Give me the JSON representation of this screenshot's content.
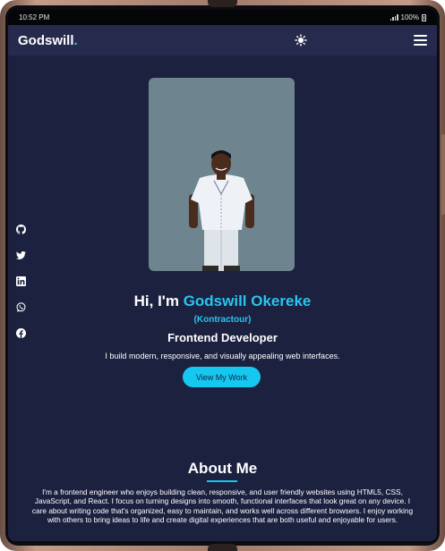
{
  "status_bar": {
    "time": "10:52 PM",
    "battery": "100%"
  },
  "navbar": {
    "logo_text": "Godswill",
    "logo_dot": "."
  },
  "hero": {
    "greeting_prefix": "Hi, I'm ",
    "name": "Godswill Okereke",
    "alias": "(Kontractour)",
    "role": "Frontend Developer",
    "tagline": "I build modern, responsive, and visually appealing web interfaces.",
    "cta_label": "View My Work"
  },
  "about": {
    "title": "About Me",
    "body": "I'm a frontend engineer who enjoys building clean, responsive, and user friendly websites using HTML5, CSS, JavaScript, and React. I focus on turning designs into smooth, functional interfaces that look great on any device. I care about writing code that's organized, easy to maintain, and works well across different browsers. I enjoy working with others to bring ideas to life and create digital experiences that are both useful and enjoyable for users."
  },
  "social_icons": [
    "github-icon",
    "twitter-icon",
    "linkedin-icon",
    "whatsapp-icon",
    "facebook-icon"
  ],
  "colors": {
    "background": "#1c2140",
    "navbar": "#262b4e",
    "accent": "#14c8f0",
    "logo_dot": "#19d3c5"
  }
}
